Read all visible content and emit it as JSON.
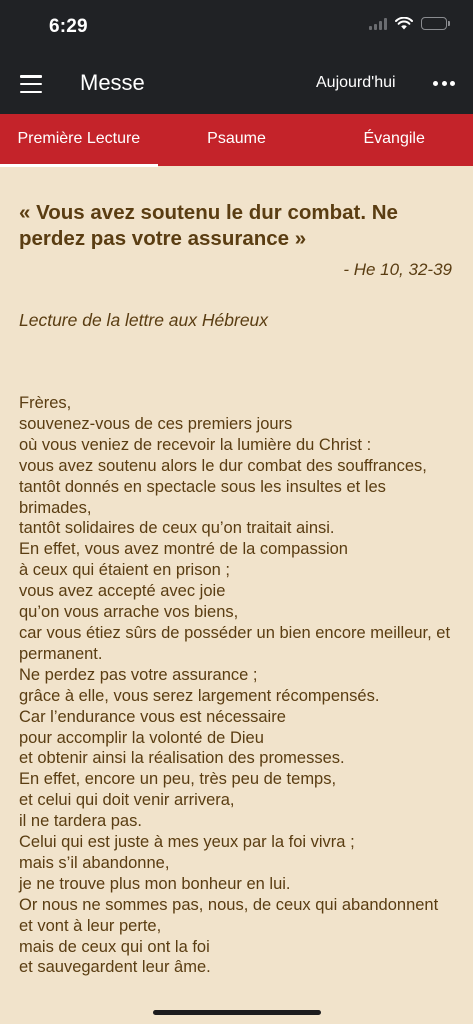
{
  "status_bar": {
    "time": "6:29"
  },
  "app_bar": {
    "title": "Messe",
    "today_label": "Aujourd'hui"
  },
  "tabs": [
    {
      "label": "Première Lecture",
      "active": true
    },
    {
      "label": "Psaume",
      "active": false
    },
    {
      "label": "Évangile",
      "active": false
    }
  ],
  "reading": {
    "title": "« Vous avez soutenu le dur combat. Ne perdez pas votre assurance »",
    "reference": "- He 10, 32-39",
    "subtitle": "Lecture de la lettre aux Hébreux",
    "lines": [
      "Frères,",
      "souvenez-vous de ces premiers jours",
      "où vous veniez de recevoir la lumière du Christ :",
      "vous avez soutenu alors le dur combat des souffrances,",
      "tantôt donnés en spectacle sous les insultes et les brimades,",
      "tantôt solidaires de ceux qu’on traitait ainsi.",
      "En effet, vous avez montré de la compassion",
      "à ceux qui étaient en prison ;",
      "vous avez accepté avec joie",
      "qu’on vous arrache vos biens,",
      "car vous étiez sûrs de posséder un bien encore meilleur, et permanent.",
      "Ne perdez pas votre assurance ;",
      "grâce à elle, vous serez largement récompensés.",
      "Car l’endurance vous est nécessaire",
      "pour accomplir la volonté de Dieu",
      "et obtenir ainsi la réalisation des promesses.",
      "En effet, encore un peu, très peu de temps,",
      "et celui qui doit venir arrivera,",
      "il ne tardera pas.",
      "Celui qui est juste à mes yeux par la foi vivra ;",
      "mais s’il abandonne,",
      "je ne trouve plus mon bonheur en lui.",
      "Or nous ne sommes pas, nous, de ceux qui abandonnent",
      "et vont à leur perte,",
      "mais de ceux qui ont la foi",
      "et sauvegardent leur âme."
    ]
  },
  "colors": {
    "app_bar": "#202225",
    "tab_bar": "#c4232a",
    "background": "#f1e3cb",
    "text": "#5a3d12"
  }
}
